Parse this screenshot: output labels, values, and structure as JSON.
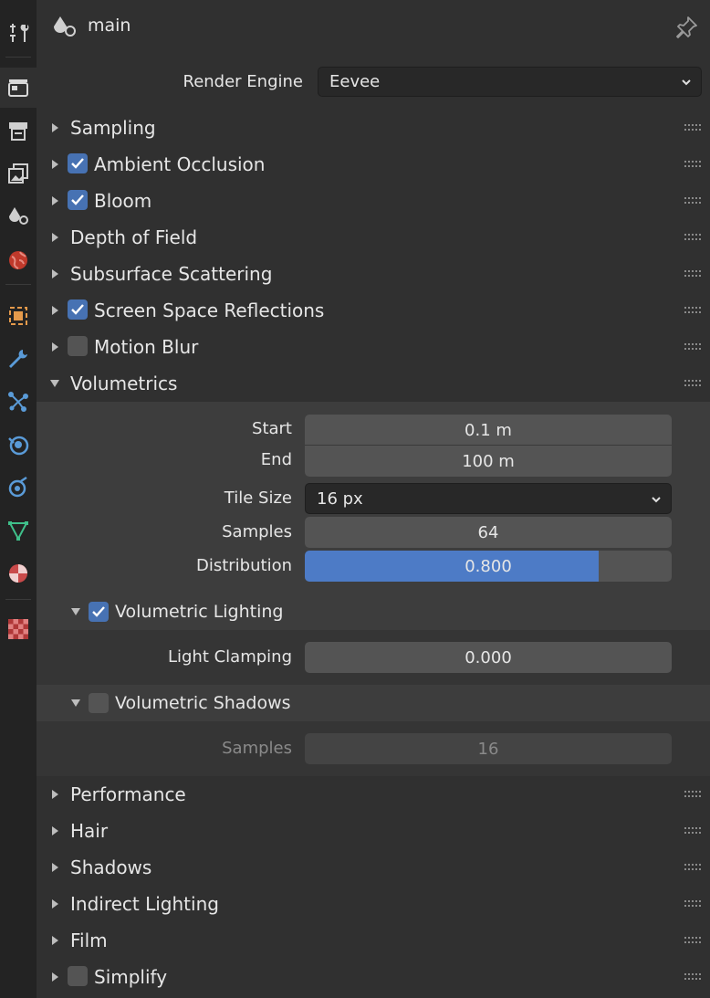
{
  "header": {
    "context_name": "main"
  },
  "render_engine": {
    "label": "Render Engine",
    "value": "Eevee"
  },
  "panels_top": [
    {
      "title": "Sampling",
      "checkbox": null
    },
    {
      "title": "Ambient Occlusion",
      "checkbox": true
    },
    {
      "title": "Bloom",
      "checkbox": true
    },
    {
      "title": "Depth of Field",
      "checkbox": null
    },
    {
      "title": "Subsurface Scattering",
      "checkbox": null
    },
    {
      "title": "Screen Space Reflections",
      "checkbox": true
    },
    {
      "title": "Motion Blur",
      "checkbox": false
    }
  ],
  "volumetrics": {
    "title": "Volumetrics",
    "start_label": "Start",
    "start_value": "0.1 m",
    "end_label": "End",
    "end_value": "100 m",
    "tile_size_label": "Tile Size",
    "tile_size_value": "16 px",
    "samples_label": "Samples",
    "samples_value": "64",
    "distribution_label": "Distribution",
    "distribution_value": "0.800",
    "distribution_fraction": 0.8,
    "lighting": {
      "title": "Volumetric Lighting",
      "checked": true,
      "clamp_label": "Light Clamping",
      "clamp_value": "0.000"
    },
    "shadows": {
      "title": "Volumetric Shadows",
      "checked": false,
      "samples_label": "Samples",
      "samples_value": "16"
    }
  },
  "panels_bottom": [
    {
      "title": "Performance",
      "checkbox": null
    },
    {
      "title": "Hair",
      "checkbox": null
    },
    {
      "title": "Shadows",
      "checkbox": null
    },
    {
      "title": "Indirect Lighting",
      "checkbox": null
    },
    {
      "title": "Film",
      "checkbox": null
    },
    {
      "title": "Simplify",
      "checkbox": false
    }
  ],
  "colors": {
    "accent": "#4772b3",
    "fill": "#4d7bc6",
    "bg": "#303030"
  },
  "tabs": [
    "tool-icon",
    "render-icon",
    "output-icon",
    "view-layer-icon",
    "scene-icon",
    "world-icon",
    "object-icon",
    "modifier-icon",
    "particles-icon",
    "physics-icon",
    "constraints-icon",
    "data-icon",
    "material-icon",
    "texture-icon"
  ]
}
